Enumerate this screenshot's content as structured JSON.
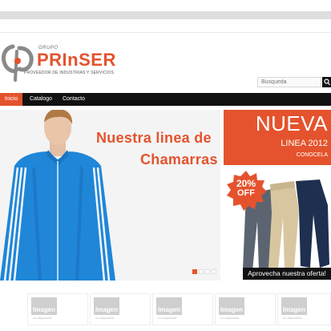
{
  "brand": {
    "grupo": "GRUPO",
    "name": "PRInSER",
    "tagline": "PROVEEDOR DE INDUSTRIAS Y SERVICIOS",
    "accent": "#e4532d"
  },
  "search": {
    "placeholder": "Busqueda"
  },
  "nav": {
    "items": [
      {
        "label": "Inicio",
        "active": true
      },
      {
        "label": "Catalogo",
        "active": false
      },
      {
        "label": "Contacto",
        "active": false
      }
    ]
  },
  "slider": {
    "line1": "Nuestra linea de",
    "line2": "Chamarras",
    "slides": 4,
    "current_slide": 1
  },
  "promo": {
    "nueva": "NUEVA",
    "linea": "LINEA 2012",
    "conocela": "CONOCELA"
  },
  "offer": {
    "badge": "20%",
    "badge2": "OFF",
    "banner": "Aprovecha nuestra oferta!"
  },
  "thumbs": {
    "items": [
      {
        "line1": "Imagen",
        "line2": "no disponible"
      },
      {
        "line1": "Imagen",
        "line2": "no disponible"
      },
      {
        "line1": "Imagen",
        "line2": "no disponible"
      },
      {
        "line1": "Imagen",
        "line2": "no disponible"
      },
      {
        "line1": "Imagen",
        "line2": "no disponible"
      }
    ]
  }
}
